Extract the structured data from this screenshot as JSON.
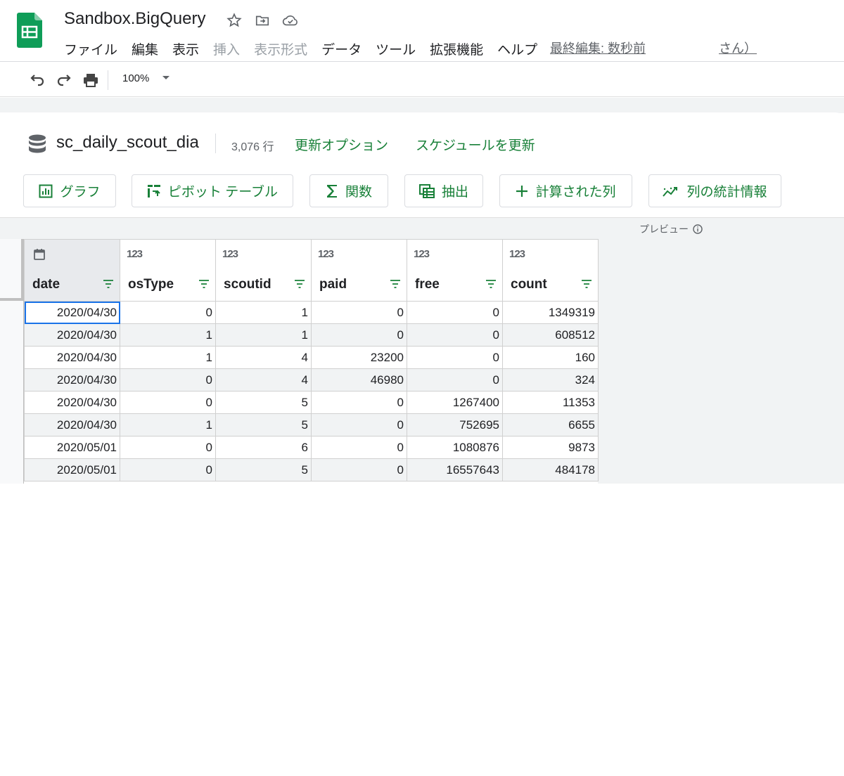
{
  "app": {
    "title": "Sandbox.BigQuery",
    "brand_color": "#0f9d58",
    "accent_color": "#188038"
  },
  "menu": [
    "ファイル",
    "編集",
    "表示",
    "挿入",
    "表示形式",
    "データ",
    "ツール",
    "拡張機能",
    "ヘルプ"
  ],
  "menu_disabled": [
    "挿入",
    "表示形式"
  ],
  "last_edit": "最終編集: 数秒前",
  "user_suffix": "さん）",
  "toolbar": {
    "zoom": "100%"
  },
  "sheet": {
    "table_name": "sc_daily_scout_dia",
    "row_count": "3,076 行",
    "refresh_options": "更新オプション",
    "update_schedule": "スケジュールを更新"
  },
  "actions": {
    "chart": "グラフ",
    "pivot": "ピボット テーブル",
    "function": "関数",
    "extract": "抽出",
    "calculated_column": "計算された列",
    "column_stats": "列の統計情報"
  },
  "preview_label": "プレビュー",
  "columns": [
    {
      "name": "date",
      "type": "date-icon"
    },
    {
      "name": "osType",
      "type_label": "123"
    },
    {
      "name": "scoutid",
      "type_label": "123"
    },
    {
      "name": "paid",
      "type_label": "123"
    },
    {
      "name": "free",
      "type_label": "123"
    },
    {
      "name": "count",
      "type_label": "123"
    }
  ],
  "rows": [
    [
      "2020/04/30",
      "0",
      "1",
      "0",
      "0",
      "1349319"
    ],
    [
      "2020/04/30",
      "1",
      "1",
      "0",
      "0",
      "608512"
    ],
    [
      "2020/04/30",
      "1",
      "4",
      "23200",
      "0",
      "160"
    ],
    [
      "2020/04/30",
      "0",
      "4",
      "46980",
      "0",
      "324"
    ],
    [
      "2020/04/30",
      "0",
      "5",
      "0",
      "1267400",
      "11353"
    ],
    [
      "2020/04/30",
      "1",
      "5",
      "0",
      "752695",
      "6655"
    ],
    [
      "2020/05/01",
      "0",
      "6",
      "0",
      "1080876",
      "9873"
    ],
    [
      "2020/05/01",
      "0",
      "5",
      "0",
      "16557643",
      "484178"
    ]
  ]
}
